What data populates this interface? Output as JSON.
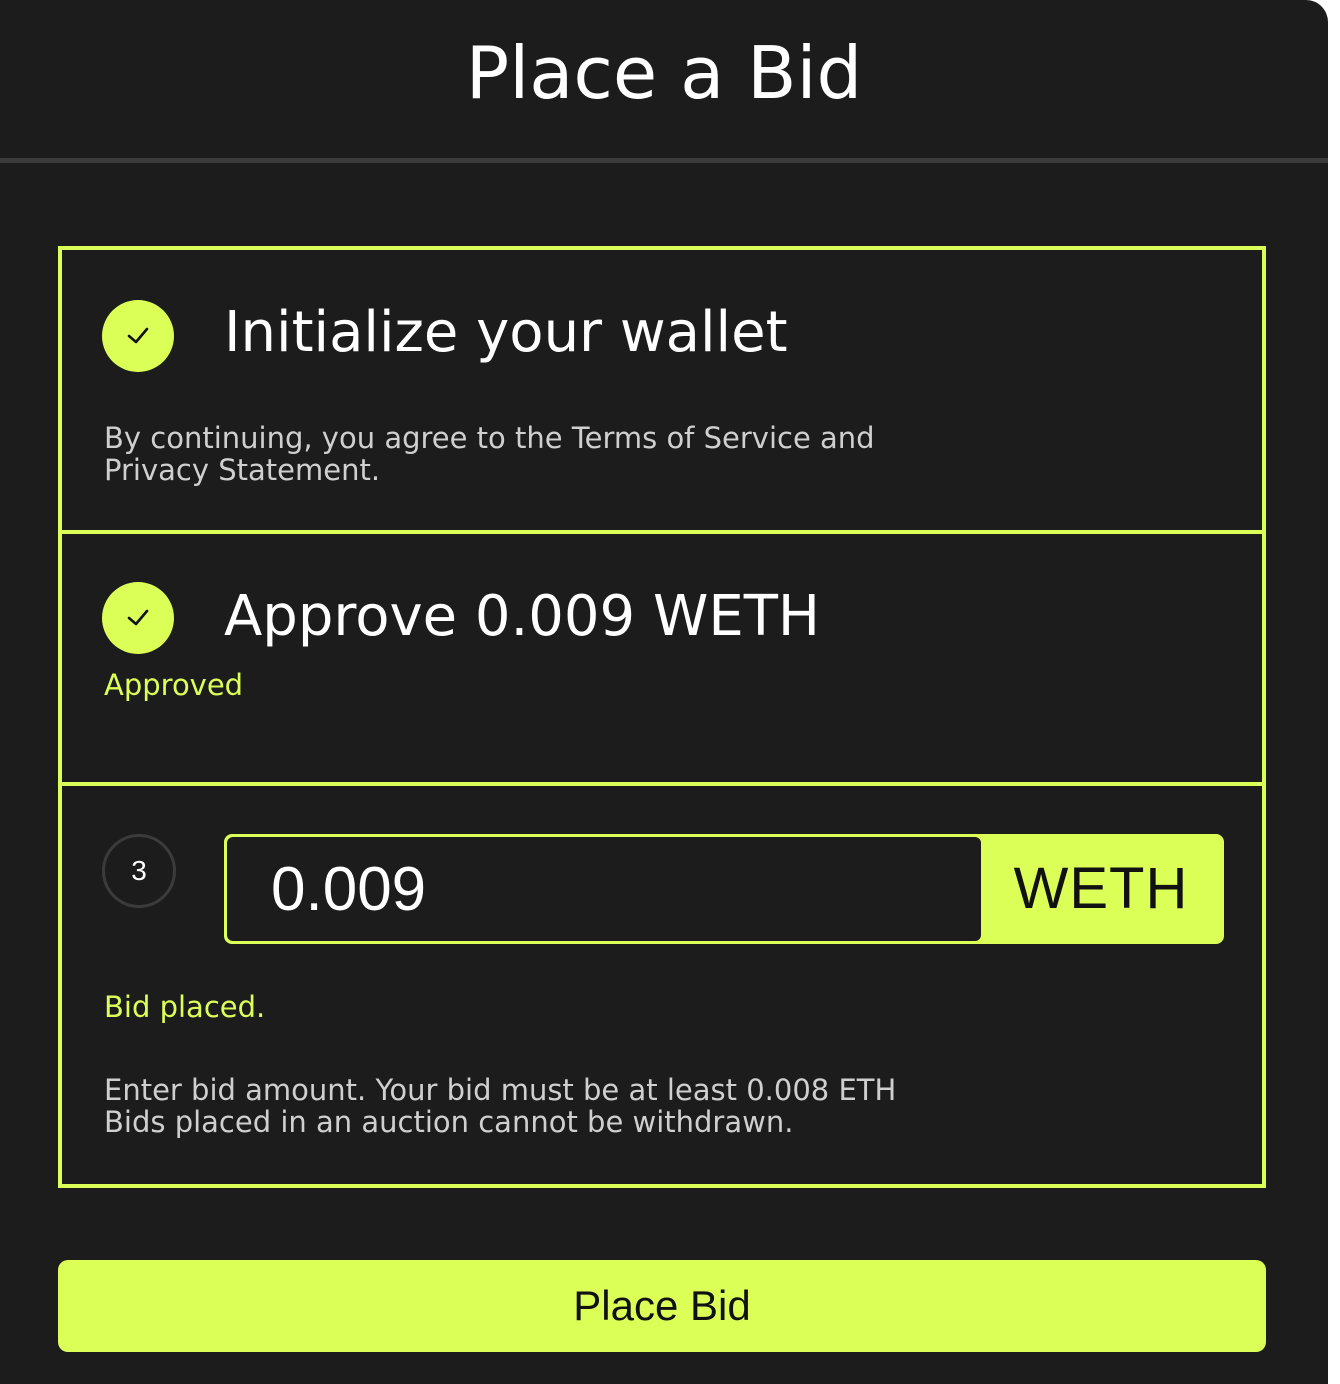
{
  "modal": {
    "title": "Place a Bid"
  },
  "steps": [
    {
      "state": "complete",
      "icon": "check-icon",
      "title": "Initialize your wallet",
      "description": "By continuing, you agree to the Terms of Service and Privacy Statement."
    },
    {
      "state": "complete",
      "icon": "check-icon",
      "title": "Approve 0.009 WETH",
      "status": "Approved"
    },
    {
      "state": "active",
      "number": "3",
      "bid_value": "0.009",
      "currency": "WETH",
      "status": "Bid placed.",
      "description_line1": "Enter bid amount. Your bid must be at least 0.008 ETH",
      "description_line2": "Bids placed in an auction cannot be withdrawn."
    }
  ],
  "actions": {
    "place_bid_label": "Place Bid"
  },
  "colors": {
    "accent": "#dcff58",
    "background": "#1c1c1c",
    "divider": "#3b3b3b",
    "text": "#ffffff",
    "muted_text": "#cfcfcf"
  }
}
